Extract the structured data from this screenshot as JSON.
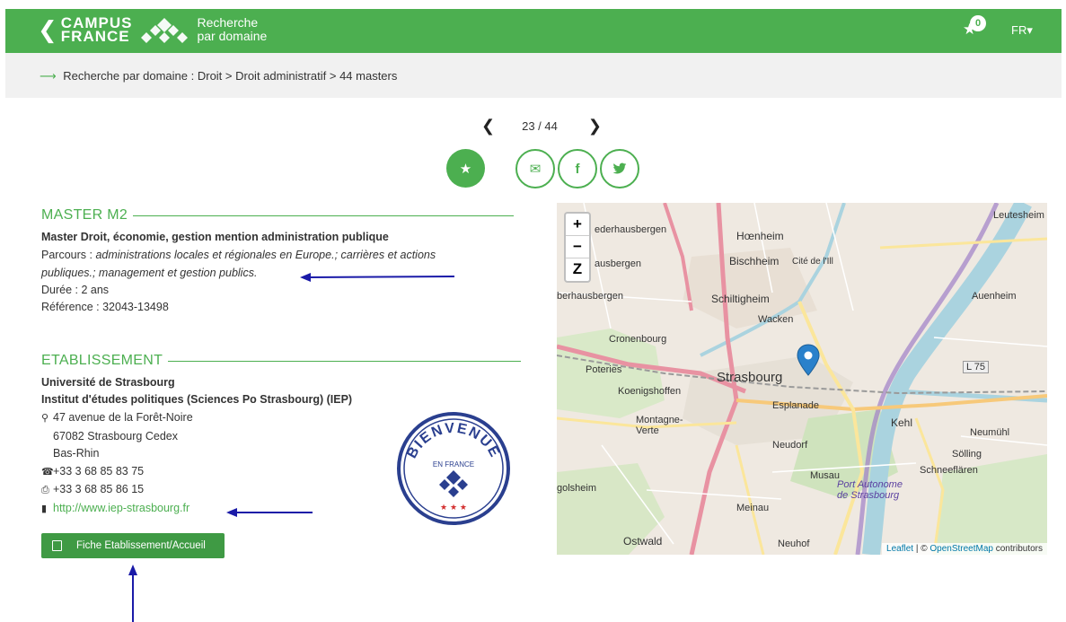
{
  "header": {
    "brand_line1": "CAMPUS",
    "brand_line2": "FRANCE",
    "subtitle_line1": "Recherche",
    "subtitle_line2": "par domaine",
    "favorites_count": "0",
    "language": "FR▾",
    "accent": "#4caf50"
  },
  "breadcrumb": {
    "text": "Recherche par domaine : Droit > Droit administratif > 44 masters"
  },
  "pager": {
    "prev": "❮",
    "next": "❯",
    "position": "23 / 44"
  },
  "actions": {
    "favorite_icon": "star-icon",
    "share_icons": [
      "envelope-icon",
      "facebook-icon",
      "twitter-icon"
    ],
    "fav_glyph": "★",
    "mail_glyph": "✉",
    "fb_glyph": "f",
    "tw_glyph": "❧"
  },
  "formation": {
    "section_title": "MASTER M2",
    "title": "Master Droit, économie, gestion mention administration publique",
    "parcours_label": "Parcours : ",
    "parcours_line1": "administrations locales et régionales en Europe.; carrières et actions",
    "parcours_line2": "publiques.; management et gestion publics.",
    "duree": "Durée : 2 ans",
    "reference": "Référence : 32043-13498"
  },
  "etablissement": {
    "section_title": "ETABLISSEMENT",
    "university": "Université de Strasbourg",
    "institute": "Institut d'études politiques (Sciences Po Strasbourg) (IEP)",
    "address1": "47 avenue de la Forêt-Noire",
    "address2": "67082 Strasbourg Cedex",
    "address3": "Bas-Rhin",
    "phone": "+33 3 68 85 83 75",
    "fax": "+33 3 68 85 86 15",
    "website": "http://www.iep-strasbourg.fr",
    "button_label": "Fiche Etablissement/Accueil"
  },
  "badge": {
    "text_top": "BIENVENUE",
    "text_mid": "EN FRANCE",
    "stars": "★ ★ ★"
  },
  "map": {
    "zoom_in": "+",
    "zoom_out": "−",
    "zoom_extra": "Z",
    "attribution_leaflet": "Leaflet",
    "attribution_sep": " | © ",
    "attribution_osm": "OpenStreetMap",
    "attribution_tail": " contributors",
    "labels": [
      "Hœnheim",
      "Bischheim",
      "Cité de l'Ill",
      "Schiltigheim",
      "Wacken",
      "Cronenbourg",
      "Poteries",
      "Koenigshoffen",
      "Strasbourg",
      "Esplanade",
      "Montagne-Verte",
      "Neudorf",
      "Kehl",
      "Neumühl",
      "Sölling",
      "Schneeflären",
      "Musau",
      "Port Autonome de Strasbourg",
      "Meinau",
      "Ostwald",
      "Neuhof",
      "Auenheim",
      "Leutesheim",
      "L 75",
      "ederhausbergen",
      "ausbergen",
      "berhausbergen",
      "golsheim"
    ]
  }
}
